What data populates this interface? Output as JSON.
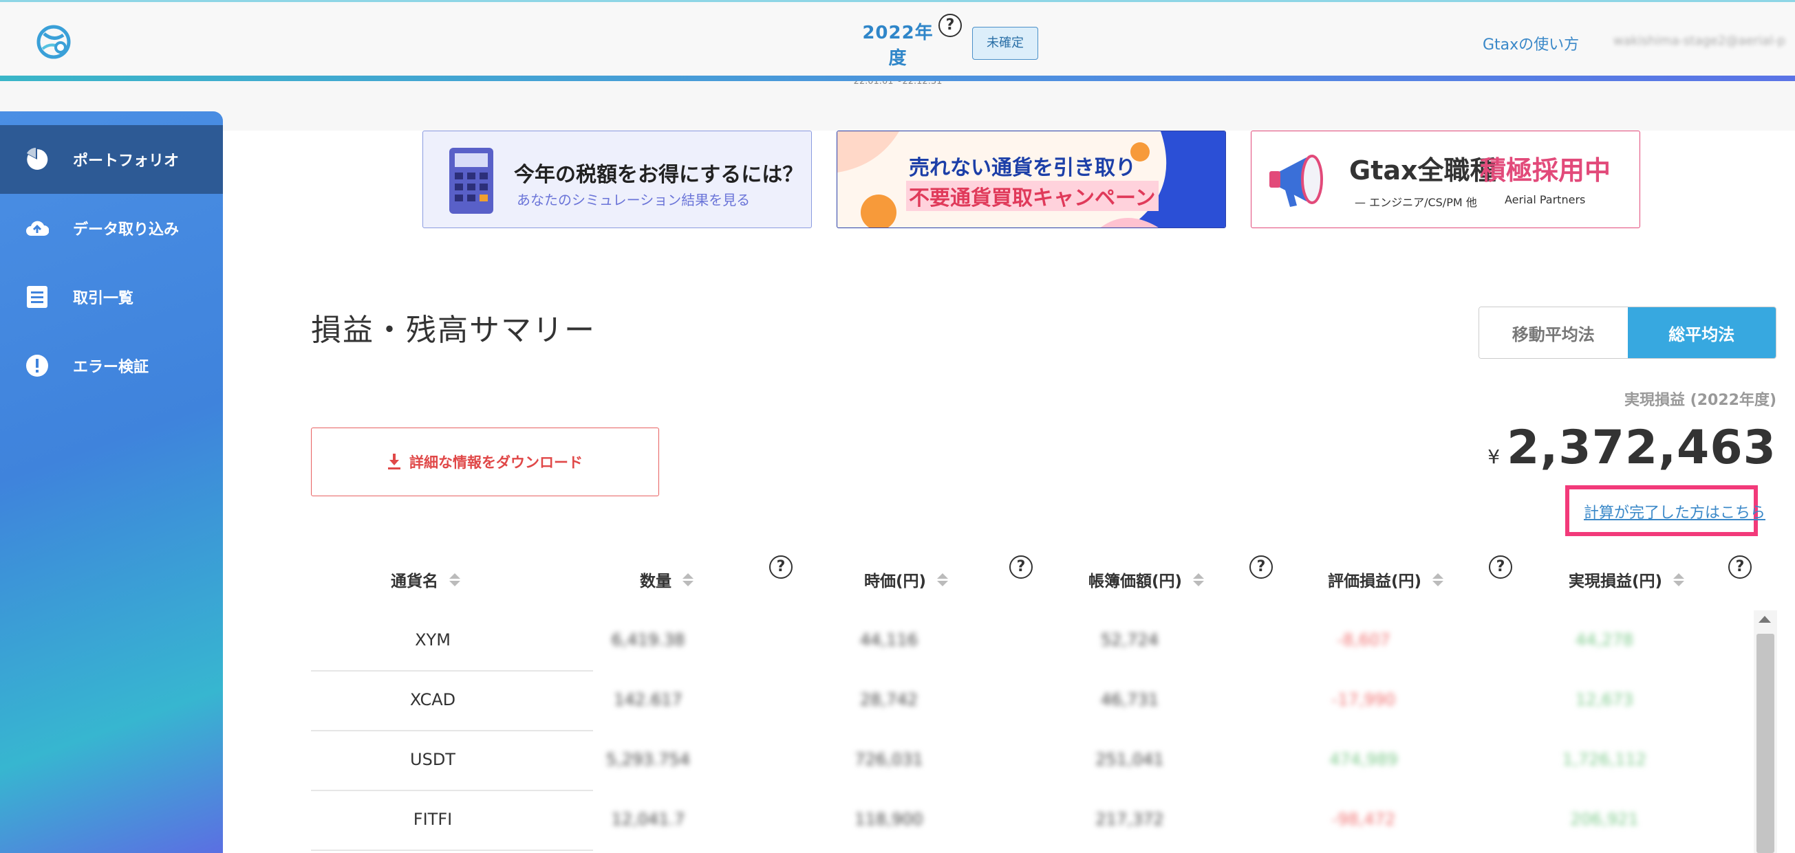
{
  "header": {
    "year_title": "2022年度",
    "year_range": "22.01.01〜22.12.31",
    "year_help": "?",
    "status_badge": "未確定",
    "howto_link": "Gtaxの使い方",
    "user_email": "wakishima-stage2@aerial-p"
  },
  "sidebar": {
    "items": [
      {
        "label": "ポートフォリオ",
        "icon": "pie-chart-icon"
      },
      {
        "label": "データ取り込み",
        "icon": "cloud-upload-icon"
      },
      {
        "label": "取引一覧",
        "icon": "list-icon"
      },
      {
        "label": "エラー検証",
        "icon": "alert-icon"
      }
    ]
  },
  "banners": [
    {
      "title": "今年の税額をお得にするには？",
      "subtitle": "あなたのシミュレーション結果を見る"
    },
    {
      "title": "売れない通貨を引き取り",
      "subtitle": "不要通貨買取キャンペーン"
    },
    {
      "title_a": "Gtax全職種",
      "title_b": "積極採用中",
      "subtitle": "— エンジニア/CS/PM 他",
      "brand": "Aerial Partners"
    }
  ],
  "main": {
    "page_title": "損益・残高サマリー",
    "toggle": {
      "option_a": "移動平均法",
      "option_b": "総平均法",
      "selected": "総平均法"
    },
    "realized_label": "実現損益 (2022年度)",
    "currency_symbol": "¥",
    "realized_value": "2,372,463",
    "done_link": "計算が完了した方はこちら",
    "download_label": "詳細な情報をダウンロード"
  },
  "table": {
    "headers": [
      "通貨名",
      "数量",
      "時価(円)",
      "帳簿価額(円)",
      "評価損益(円)",
      "実現損益(円)"
    ],
    "help": "?",
    "rows": [
      {
        "name": "XYM",
        "qty": "6,419.38",
        "price": "44,116",
        "book": "52,724",
        "unrealized": "-8,607",
        "realized": "44,278"
      },
      {
        "name": "XCAD",
        "qty": "142.617",
        "price": "28,742",
        "book": "46,731",
        "unrealized": "-17,990",
        "realized": "12,673"
      },
      {
        "name": "USDT",
        "qty": "5,293.754",
        "price": "726,031",
        "book": "251,041",
        "unrealized": "474,989",
        "realized": "1,726,112"
      },
      {
        "name": "FITFI",
        "qty": "12,041.7",
        "price": "118,900",
        "book": "217,372",
        "unrealized": "-98,472",
        "realized": "206,921"
      }
    ]
  },
  "colors": {
    "accent": "#37a8e0",
    "sidebar_active": "#2d5a95",
    "highlight": "#f23a7a",
    "download": "#e04848"
  }
}
